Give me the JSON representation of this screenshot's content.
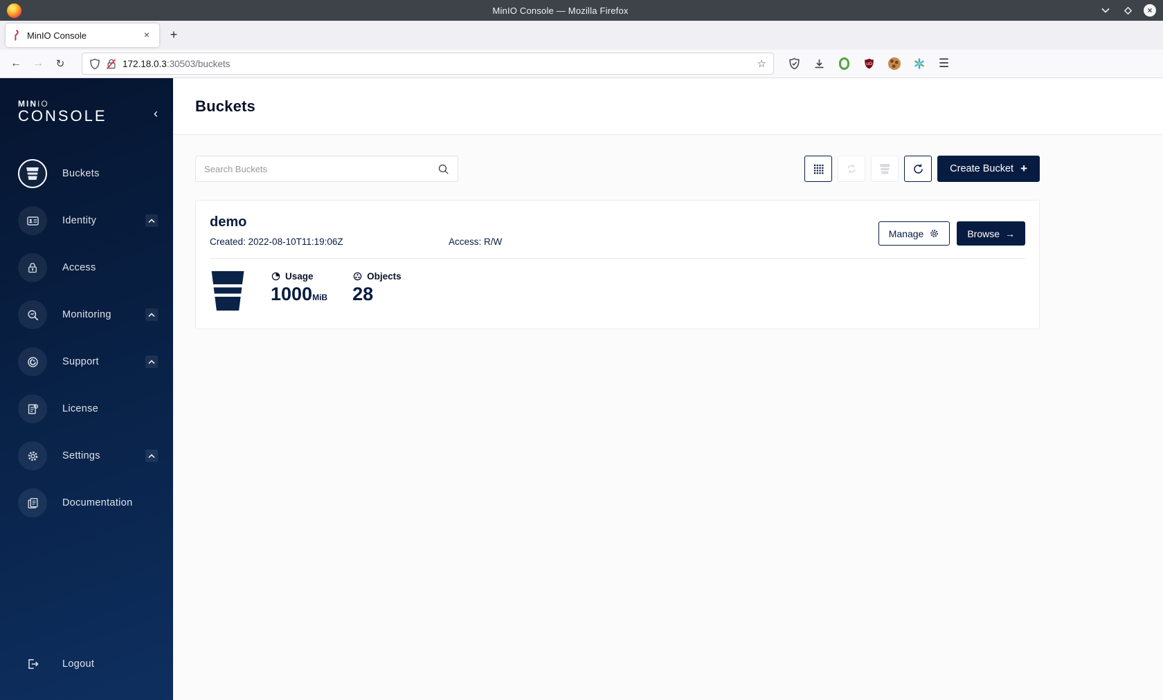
{
  "window": {
    "title": "MinIO Console — Mozilla Firefox"
  },
  "browser": {
    "tab_title": "MinIO Console",
    "url_host": "172.18.0.3",
    "url_rest": ":30503/buckets"
  },
  "glyphs": {
    "back": "←",
    "forward": "→",
    "reload": "↻",
    "star": "☆",
    "menu": "☰",
    "new_tab": "+",
    "tab_close": "×",
    "collapse": "‹",
    "create_plus": "+",
    "browse_arrow": "→",
    "refresh": "↻"
  },
  "sidebar": {
    "logo_bold": "MIN",
    "logo_light": "IO",
    "logo_line2": "CONSOLE",
    "items": [
      {
        "label": "Buckets",
        "active": true,
        "expandable": false
      },
      {
        "label": "Identity",
        "active": false,
        "expandable": true
      },
      {
        "label": "Access",
        "active": false,
        "expandable": false
      },
      {
        "label": "Monitoring",
        "active": false,
        "expandable": true
      },
      {
        "label": "Support",
        "active": false,
        "expandable": true
      },
      {
        "label": "License",
        "active": false,
        "expandable": false
      },
      {
        "label": "Settings",
        "active": false,
        "expandable": true
      },
      {
        "label": "Documentation",
        "active": false,
        "expandable": false
      }
    ],
    "logout_label": "Logout"
  },
  "header": {
    "title": "Buckets"
  },
  "actions": {
    "search_placeholder": "Search Buckets",
    "create_label": "Create Bucket"
  },
  "bucket": {
    "name": "demo",
    "created": "Created: 2022-08-10T11:19:06Z",
    "access": "Access: R/W",
    "manage_label": "Manage",
    "browse_label": "Browse",
    "usage_label": "Usage",
    "usage_value": "1000",
    "usage_unit": "MiB",
    "objects_label": "Objects",
    "objects_value": "28"
  },
  "colors": {
    "accent_navy": "#081C42",
    "sidebar_top": "#061530",
    "sidebar_bottom": "#0e2f5f",
    "titlebar": "#3e4349",
    "disabled_icon": "#d8dade",
    "insecure_slash": "#e8304f"
  }
}
